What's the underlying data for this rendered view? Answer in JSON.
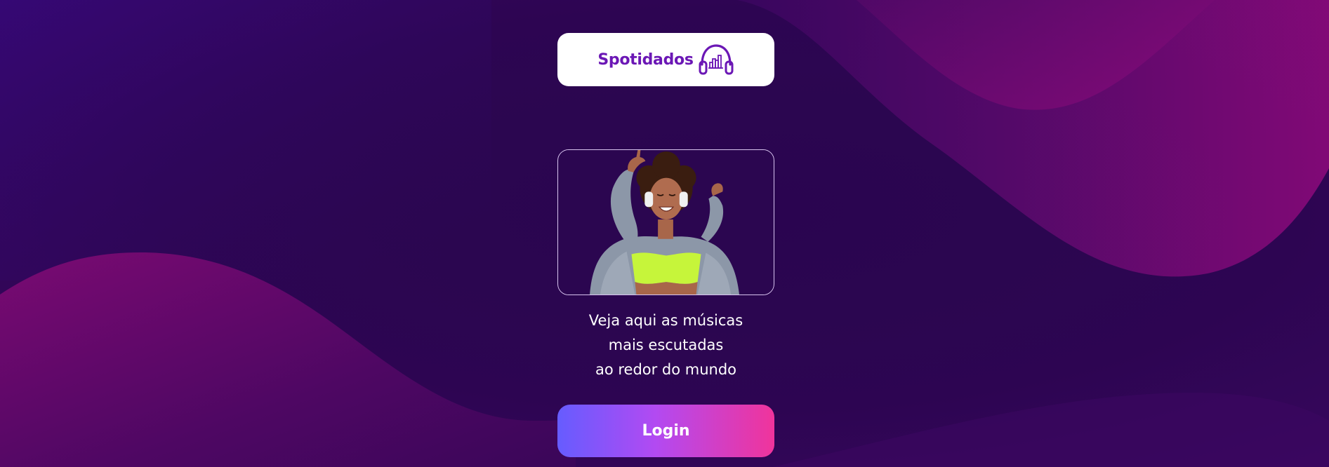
{
  "brand": {
    "name": "Spotidados",
    "icon": "headphones-chart-icon",
    "color": "#6b17b5"
  },
  "hero": {
    "image": "woman-dancing-with-headphones"
  },
  "tagline": {
    "line1": "Veja aqui as músicas",
    "line2": "mais escutadas",
    "line3": "ao redor do mundo"
  },
  "login": {
    "label": "Login",
    "gradient": [
      "#665cff",
      "#b24af2",
      "#f0349b"
    ]
  },
  "theme": {
    "background": "#2b0650",
    "wave_accent": "#8a0a78"
  }
}
